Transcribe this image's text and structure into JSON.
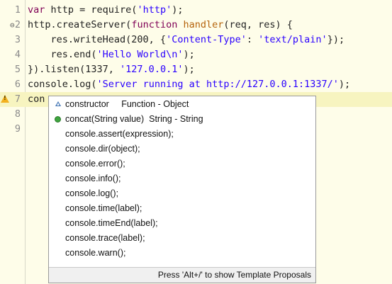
{
  "editor": {
    "lines": [
      {
        "num": "1",
        "fold": "",
        "parts": [
          {
            "t": "var",
            "c": "kw"
          },
          {
            "t": " http = require(",
            "c": ""
          },
          {
            "t": "'http'",
            "c": "str"
          },
          {
            "t": ");",
            "c": ""
          }
        ]
      },
      {
        "num": "2",
        "fold": "⊖",
        "parts": [
          {
            "t": "http.createServer(",
            "c": ""
          },
          {
            "t": "function",
            "c": "kw"
          },
          {
            "t": " ",
            "c": ""
          },
          {
            "t": "handler",
            "c": "fn"
          },
          {
            "t": "(req, res) {",
            "c": ""
          }
        ]
      },
      {
        "num": "3",
        "fold": "",
        "parts": [
          {
            "t": "    res.writeHead(200, {",
            "c": ""
          },
          {
            "t": "'Content-Type'",
            "c": "str"
          },
          {
            "t": ": ",
            "c": ""
          },
          {
            "t": "'text/plain'",
            "c": "str"
          },
          {
            "t": "});",
            "c": ""
          }
        ]
      },
      {
        "num": "4",
        "fold": "",
        "parts": [
          {
            "t": "    res.end(",
            "c": ""
          },
          {
            "t": "'Hello World\\n'",
            "c": "str"
          },
          {
            "t": ");",
            "c": ""
          }
        ]
      },
      {
        "num": "5",
        "fold": "",
        "parts": [
          {
            "t": "}).listen(1337, ",
            "c": ""
          },
          {
            "t": "'127.0.0.1'",
            "c": "str"
          },
          {
            "t": ");",
            "c": ""
          }
        ]
      },
      {
        "num": "6",
        "fold": "",
        "parts": [
          {
            "t": "console.log(",
            "c": ""
          },
          {
            "t": "'Server running at http://127.0.0.1:1337/'",
            "c": "str"
          },
          {
            "t": ");",
            "c": ""
          }
        ]
      },
      {
        "num": "7",
        "fold": "",
        "warning": true,
        "current": true,
        "parts": [
          {
            "t": "con",
            "c": ""
          }
        ]
      },
      {
        "num": "8",
        "fold": "",
        "parts": []
      },
      {
        "num": "9",
        "fold": "",
        "parts": []
      }
    ]
  },
  "content_assist": {
    "proposals": [
      {
        "label": "constructor     Function - Object",
        "icon": "triangle"
      },
      {
        "label": "concat(String value)  String - String",
        "icon": "dot"
      },
      {
        "label": "console.assert(expression);",
        "icon": ""
      },
      {
        "label": "console.dir(object);",
        "icon": ""
      },
      {
        "label": "console.error();",
        "icon": ""
      },
      {
        "label": "console.info();",
        "icon": ""
      },
      {
        "label": "console.log();",
        "icon": ""
      },
      {
        "label": "console.time(label);",
        "icon": ""
      },
      {
        "label": "console.timeEnd(label);",
        "icon": ""
      },
      {
        "label": "console.trace(label);",
        "icon": ""
      },
      {
        "label": "console.warn();",
        "icon": ""
      }
    ],
    "footer": "Press 'Alt+/' to show Template Proposals"
  }
}
